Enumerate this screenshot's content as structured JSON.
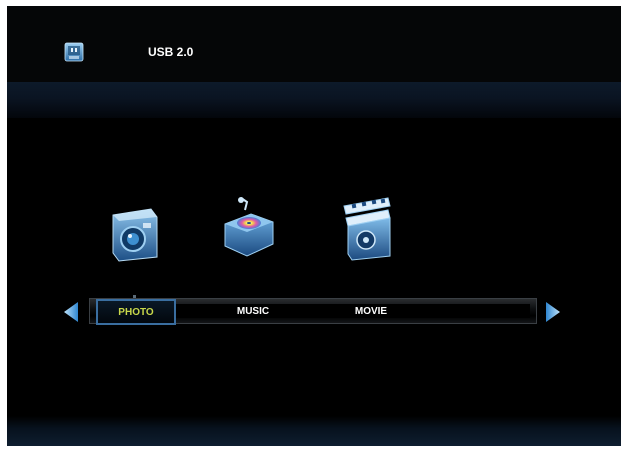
{
  "header": {
    "device_title": "USB 2.0",
    "icon": "usb-drive-icon"
  },
  "media_icons": [
    {
      "name": "photo-camera-icon"
    },
    {
      "name": "music-box-icon"
    },
    {
      "name": "movie-clapper-icon"
    }
  ],
  "menu": {
    "items": [
      {
        "label": "PHOTO",
        "selected": true
      },
      {
        "label": "MUSIC",
        "selected": false
      },
      {
        "label": "MOVIE",
        "selected": false
      }
    ],
    "prev_icon": "arrow-left-icon",
    "next_icon": "arrow-right-icon"
  },
  "colors": {
    "background": "#000000",
    "selected_text": "#c9d84a",
    "selected_border": "#3a6ea0",
    "accent_blue": "#4aa8e8",
    "text": "#ffffff"
  }
}
